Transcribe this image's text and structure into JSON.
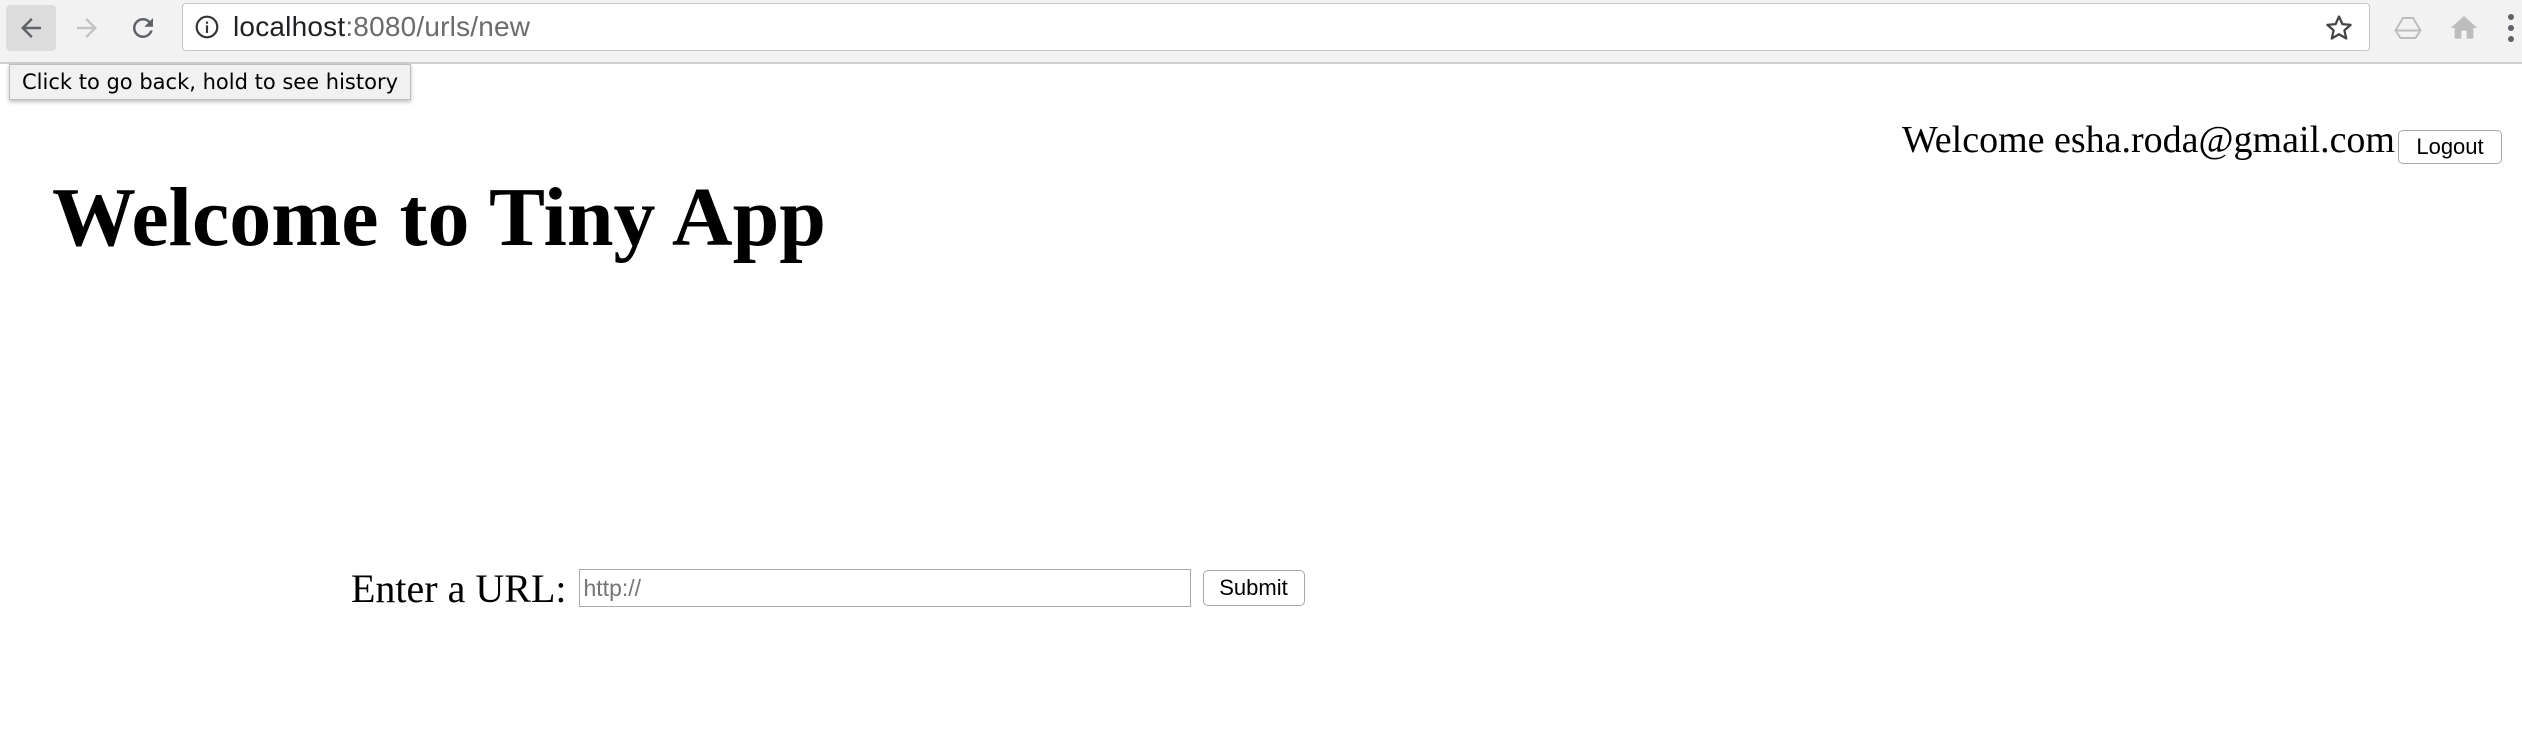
{
  "browser": {
    "address_bar": {
      "host": "localhost",
      "path": ":8080/urls/new"
    },
    "tooltip": "Click to go back, hold to see history",
    "icons": {
      "back": "back-arrow-icon",
      "forward": "forward-arrow-icon",
      "reload": "reload-icon",
      "info": "info-icon",
      "star": "star-icon",
      "drive": "drive-icon",
      "home": "home-icon",
      "menu": "kebab-menu-icon"
    }
  },
  "header": {
    "welcome_text": "Welcome esha.roda@gmail.com",
    "logout_label": "Logout"
  },
  "main": {
    "title": "Welcome to Tiny App",
    "form": {
      "label": "Enter a URL:",
      "input_placeholder": "http://",
      "input_value": "",
      "submit_label": "Submit"
    }
  }
}
